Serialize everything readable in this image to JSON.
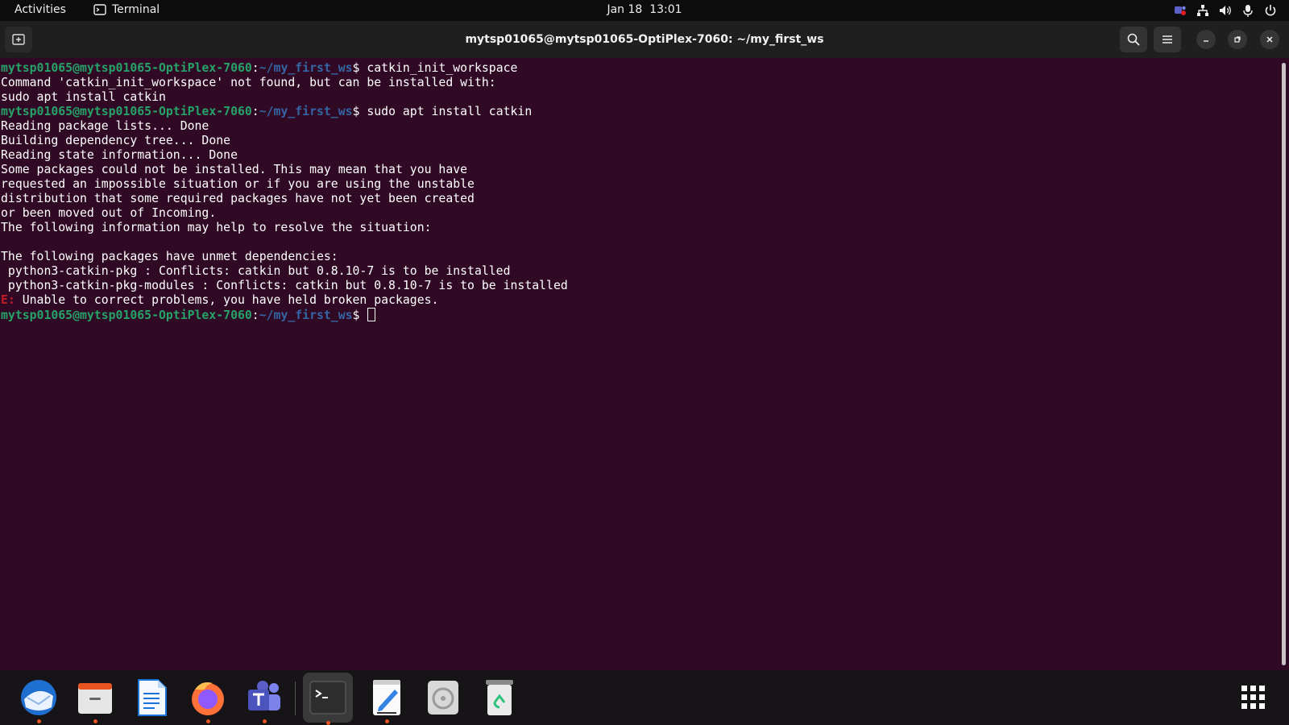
{
  "topbar": {
    "activities": "Activities",
    "app_name": "Terminal",
    "date": "Jan 18",
    "time": "13:01",
    "tray_icons": [
      "teams-icon",
      "network-icon",
      "volume-icon",
      "microphone-icon",
      "power-icon"
    ]
  },
  "window": {
    "title": "mytsp01065@mytsp01065-OptiPlex-7060: ~/my_first_ws",
    "buttons": [
      "new-tab",
      "search",
      "menu",
      "minimize",
      "restore",
      "close"
    ]
  },
  "terminal": {
    "prompt_user": "mytsp01065@mytsp01065-OptiPlex-7060",
    "prompt_path": "~/my_first_ws",
    "cmd1": "catkin_init_workspace",
    "out1": [
      "Command 'catkin_init_workspace' not found, but can be installed with:",
      "sudo apt install catkin"
    ],
    "cmd2": "sudo apt install catkin",
    "out2": [
      "Reading package lists... Done",
      "Building dependency tree... Done",
      "Reading state information... Done",
      "Some packages could not be installed. This may mean that you have",
      "requested an impossible situation or if you are using the unstable",
      "distribution that some required packages have not yet been created",
      "or been moved out of Incoming.",
      "The following information may help to resolve the situation:",
      "",
      "The following packages have unmet dependencies:",
      " python3-catkin-pkg : Conflicts: catkin but 0.8.10-7 is to be installed",
      " python3-catkin-pkg-modules : Conflicts: catkin but 0.8.10-7 is to be installed"
    ],
    "error_prefix": "E:",
    "error_text": " Unable to correct problems, you have held broken packages."
  },
  "dock": {
    "items": [
      {
        "name": "thunderbird-icon",
        "running": true
      },
      {
        "name": "files-icon",
        "running": true
      },
      {
        "name": "libreoffice-writer-icon",
        "running": false
      },
      {
        "name": "firefox-icon",
        "running": true
      },
      {
        "name": "teams-icon",
        "running": true
      },
      {
        "name": "terminal-icon",
        "running": true,
        "active": true
      },
      {
        "name": "text-editor-icon",
        "running": true
      },
      {
        "name": "disc-icon",
        "running": false
      },
      {
        "name": "trash-icon",
        "running": false
      }
    ],
    "show_apps": "show-apps-icon"
  },
  "colors": {
    "terminal_bg": "#300a24",
    "prompt_user": "#26a269",
    "prompt_path": "#3465a4",
    "error": "#c01c28",
    "running_dot": "#e95420"
  }
}
